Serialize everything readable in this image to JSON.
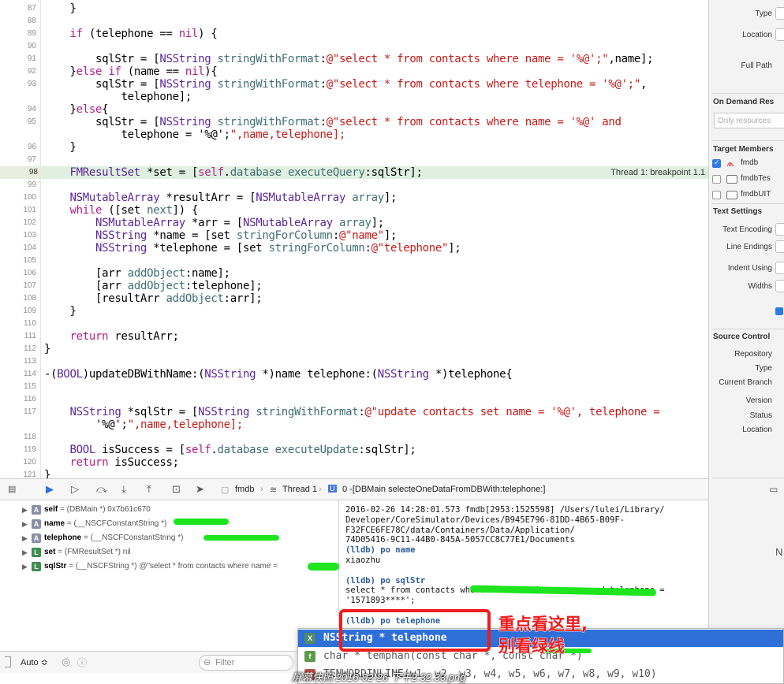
{
  "editor": {
    "lines": [
      {
        "n": "87",
        "code": "    }"
      },
      {
        "n": "88",
        "code": ""
      },
      {
        "n": "89",
        "code": "    if (telephone == nil) {"
      },
      {
        "n": "90",
        "code": ""
      },
      {
        "n": "91",
        "code": "        sqlStr = [NSString stringWithFormat:@\"select * from contacts where name = '%@';\",name];"
      },
      {
        "n": "92",
        "code": "    }else if (name == nil){"
      },
      {
        "n": "93",
        "code": "        sqlStr = [NSString stringWithFormat:@\"select * from contacts where telephone = '%@';\","
      },
      {
        "n": "",
        "code": "            telephone];"
      },
      {
        "n": "94",
        "code": "    }else{"
      },
      {
        "n": "95",
        "code": "        sqlStr = [NSString stringWithFormat:@\"select * from contacts where name = '%@' and"
      },
      {
        "n": "",
        "code": "            telephone = '%@';\",name,telephone];"
      },
      {
        "n": "96",
        "code": "    }"
      },
      {
        "n": "97",
        "code": ""
      },
      {
        "n": "98",
        "code": "    FMResultSet *set = [self.database executeQuery:sqlStr];"
      },
      {
        "n": "99",
        "code": ""
      },
      {
        "n": "100",
        "code": "    NSMutableArray *resultArr = [NSMutableArray array];"
      },
      {
        "n": "101",
        "code": "    while ([set next]) {"
      },
      {
        "n": "102",
        "code": "        NSMutableArray *arr = [NSMutableArray array];"
      },
      {
        "n": "103",
        "code": "        NSString *name = [set stringForColumn:@\"name\"];"
      },
      {
        "n": "104",
        "code": "        NSString *telephone = [set stringForColumn:@\"telephone\"];"
      },
      {
        "n": "105",
        "code": ""
      },
      {
        "n": "106",
        "code": "        [arr addObject:name];"
      },
      {
        "n": "107",
        "code": "        [arr addObject:telephone];"
      },
      {
        "n": "108",
        "code": "        [resultArr addObject:arr];"
      },
      {
        "n": "109",
        "code": "    }"
      },
      {
        "n": "110",
        "code": ""
      },
      {
        "n": "111",
        "code": "    return resultArr;"
      },
      {
        "n": "112",
        "code": "}"
      },
      {
        "n": "113",
        "code": ""
      },
      {
        "n": "114",
        "code": "-(BOOL)updateDBWithName:(NSString *)name telephone:(NSString *)telephone{"
      },
      {
        "n": "115",
        "code": ""
      },
      {
        "n": "116",
        "code": ""
      },
      {
        "n": "117",
        "code": "    NSString *sqlStr = [NSString stringWithFormat:@\"update contacts set name = '%@', telephone ="
      },
      {
        "n": "",
        "code": "        '%@';\",name,telephone];"
      },
      {
        "n": "118",
        "code": ""
      },
      {
        "n": "119",
        "code": "    BOOL isSuccess = [self.database executeUpdate:sqlStr];"
      },
      {
        "n": "120",
        "code": "    return isSuccess;"
      },
      {
        "n": "121",
        "code": "}"
      }
    ],
    "breakpoint_line": "98",
    "thread_label": "Thread 1: breakpoint 1.1"
  },
  "inspector": {
    "type_label": "Type",
    "location_label": "Location",
    "full_path_label": "Full Path",
    "on_demand_heading": "On Demand Res",
    "only_resources_placeholder": "Only resources",
    "target_members_heading": "Target Members",
    "targets": [
      {
        "label": "fmdb",
        "checked": true
      },
      {
        "label": "fmdbTes",
        "checked": false
      },
      {
        "label": "fmdbUIT",
        "checked": false
      }
    ],
    "text_settings_heading": "Text Settings",
    "text_encoding_label": "Text Encoding",
    "line_endings_label": "Line Endings",
    "indent_using_label": "Indent Using",
    "widths_label": "Widths",
    "source_control_heading": "Source Control",
    "repository_label": "Repository",
    "sc_type_label": "Type",
    "current_branch_label": "Current Branch",
    "version_label": "Version",
    "status_label": "Status",
    "sc_location_label": "Location",
    "n_label": "N"
  },
  "debug_bar": {
    "target": "fmdb",
    "thread": "Thread 1",
    "frame": "0 -[DBMain selecteOneDataFromDBWith:telephone:]"
  },
  "variables": [
    {
      "badge": "A",
      "name": "self",
      "type": "(DBMain *)",
      "value": "0x7b61c670"
    },
    {
      "badge": "A",
      "name": "name",
      "type": "(__NSCFConstantString *)",
      "value": ""
    },
    {
      "badge": "A",
      "name": "telephone",
      "type": "(__NSCFConstantString *)",
      "value": ""
    },
    {
      "badge": "L",
      "name": "set",
      "type": "(FMResultSet *)",
      "value": "nil"
    },
    {
      "badge": "L",
      "name": "sqlStr",
      "type": "(__NSCFString *)",
      "value": "@\"select * from contacts where name = "
    }
  ],
  "console": [
    {
      "text": "2016-02-26 14:28:01.573 fmdb[2953:1525598] /Users/lulei/Library/",
      "kind": "out"
    },
    {
      "text": "Developer/CoreSimulator/Devices/B945E796-81DD-4B65-B09F-",
      "kind": "out"
    },
    {
      "text": "F32FCE6FE78C/data/Containers/Data/Application/",
      "kind": "out"
    },
    {
      "text": "74D05416-9C11-44B0-845A-5057CC8C77E1/Documents",
      "kind": "out"
    },
    {
      "text": "(lldb) po name",
      "kind": "lldb"
    },
    {
      "text": "xiaozhu",
      "kind": "out"
    },
    {
      "text": "",
      "kind": "out"
    },
    {
      "text": "(lldb) po sqlStr",
      "kind": "lldb"
    },
    {
      "text": "select * from contacts where name = 'xi          and telephone =",
      "kind": "out"
    },
    {
      "text": "'1571893****';",
      "kind": "out"
    },
    {
      "text": "",
      "kind": "out"
    },
    {
      "text": "(lldb) po telephone",
      "kind": "lldb"
    }
  ],
  "bottom_bar": {
    "auto_label": "Auto ≎",
    "filter_placeholder": "Filter"
  },
  "completion": [
    {
      "badge": "X",
      "text": "NSString * telephone",
      "selected": true
    },
    {
      "badge": "f",
      "text": "char * temphan(const char *, const char *)",
      "selected": false
    },
    {
      "badge": "M",
      "text": "TENWORDINLINE(w1, w2, w3, w4, w5, w6, w7, w8, w9, w10)",
      "selected": false
    }
  ],
  "annotation": {
    "line1": "重点看这里,",
    "line2": "别看绿线"
  },
  "watermark": "屏幕快照 2016-02-26 下午2.32.33.png"
}
